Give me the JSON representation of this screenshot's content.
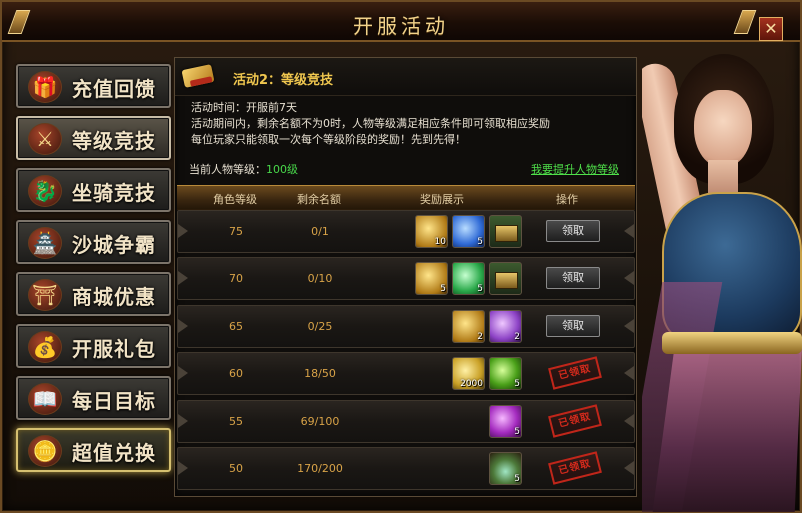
{
  "window": {
    "title": "开服活动",
    "close_symbol": "✕"
  },
  "nav": {
    "items": [
      {
        "label": "充值回馈",
        "icon": "gift-bag-icon",
        "glyph": "🎁"
      },
      {
        "label": "等级竞技",
        "icon": "crossed-swords-icon",
        "glyph": "⚔"
      },
      {
        "label": "坐骑竞技",
        "icon": "dragon-mount-icon",
        "glyph": "🐉"
      },
      {
        "label": "沙城争霸",
        "icon": "castle-icon",
        "glyph": "🏯"
      },
      {
        "label": "商城优惠",
        "icon": "pagoda-shop-icon",
        "glyph": "⛩"
      },
      {
        "label": "开服礼包",
        "icon": "gold-bag-icon",
        "glyph": "💰"
      },
      {
        "label": "每日目标",
        "icon": "open-book-icon",
        "glyph": "📖"
      },
      {
        "label": "超值兑换",
        "icon": "gold-coins-icon",
        "glyph": "🪙"
      }
    ],
    "active_index": 1
  },
  "panel": {
    "activity_title": "活动2：等级竞技",
    "desc_line1": "活动时间：开服前7天",
    "desc_line2": "活动期间内，剩余名额不为0时，人物等级满足相应条件即可领取相应奖励",
    "desc_line3": "每位玩家只能领取一次每个等级阶段的奖励！先到先得！",
    "current_level_label": "当前人物等级：",
    "current_level_value": "100级",
    "upgrade_link": "我要提升人物等级",
    "headers": {
      "level": "角色等级",
      "remaining": "剩余名额",
      "rewards": "奖励展示",
      "action": "操作"
    },
    "rows": [
      {
        "level": "75",
        "remaining": "0/1",
        "items": [
          {
            "type": "gold-ticket",
            "count": "10"
          },
          {
            "type": "blue-stone",
            "count": "5"
          },
          {
            "type": "chest",
            "count": ""
          }
        ],
        "action": "领取",
        "claimed": false
      },
      {
        "level": "70",
        "remaining": "0/10",
        "items": [
          {
            "type": "gold-ticket",
            "count": "5"
          },
          {
            "type": "green-stone",
            "count": "5"
          },
          {
            "type": "chest",
            "count": ""
          }
        ],
        "action": "领取",
        "claimed": false
      },
      {
        "level": "65",
        "remaining": "0/25",
        "items": [
          {
            "type": "gold-ticket",
            "count": "2"
          },
          {
            "type": "purple-stone",
            "count": "2"
          }
        ],
        "action": "领取",
        "claimed": false
      },
      {
        "level": "60",
        "remaining": "18/50",
        "items": [
          {
            "type": "coin-pile",
            "count": "2000"
          },
          {
            "type": "green-orb",
            "count": "5"
          }
        ],
        "action": "已领取",
        "claimed": true
      },
      {
        "level": "55",
        "remaining": "69/100",
        "items": [
          {
            "type": "violet-orb",
            "count": "5"
          }
        ],
        "action": "已领取",
        "claimed": true
      },
      {
        "level": "50",
        "remaining": "170/200",
        "items": [
          {
            "type": "gem-chest",
            "count": "5"
          }
        ],
        "action": "已领取",
        "claimed": true
      }
    ]
  },
  "colors": {
    "accent_gold": "#f0c74f",
    "link_green": "#4fe04a",
    "stamp_red": "#c0261a"
  }
}
